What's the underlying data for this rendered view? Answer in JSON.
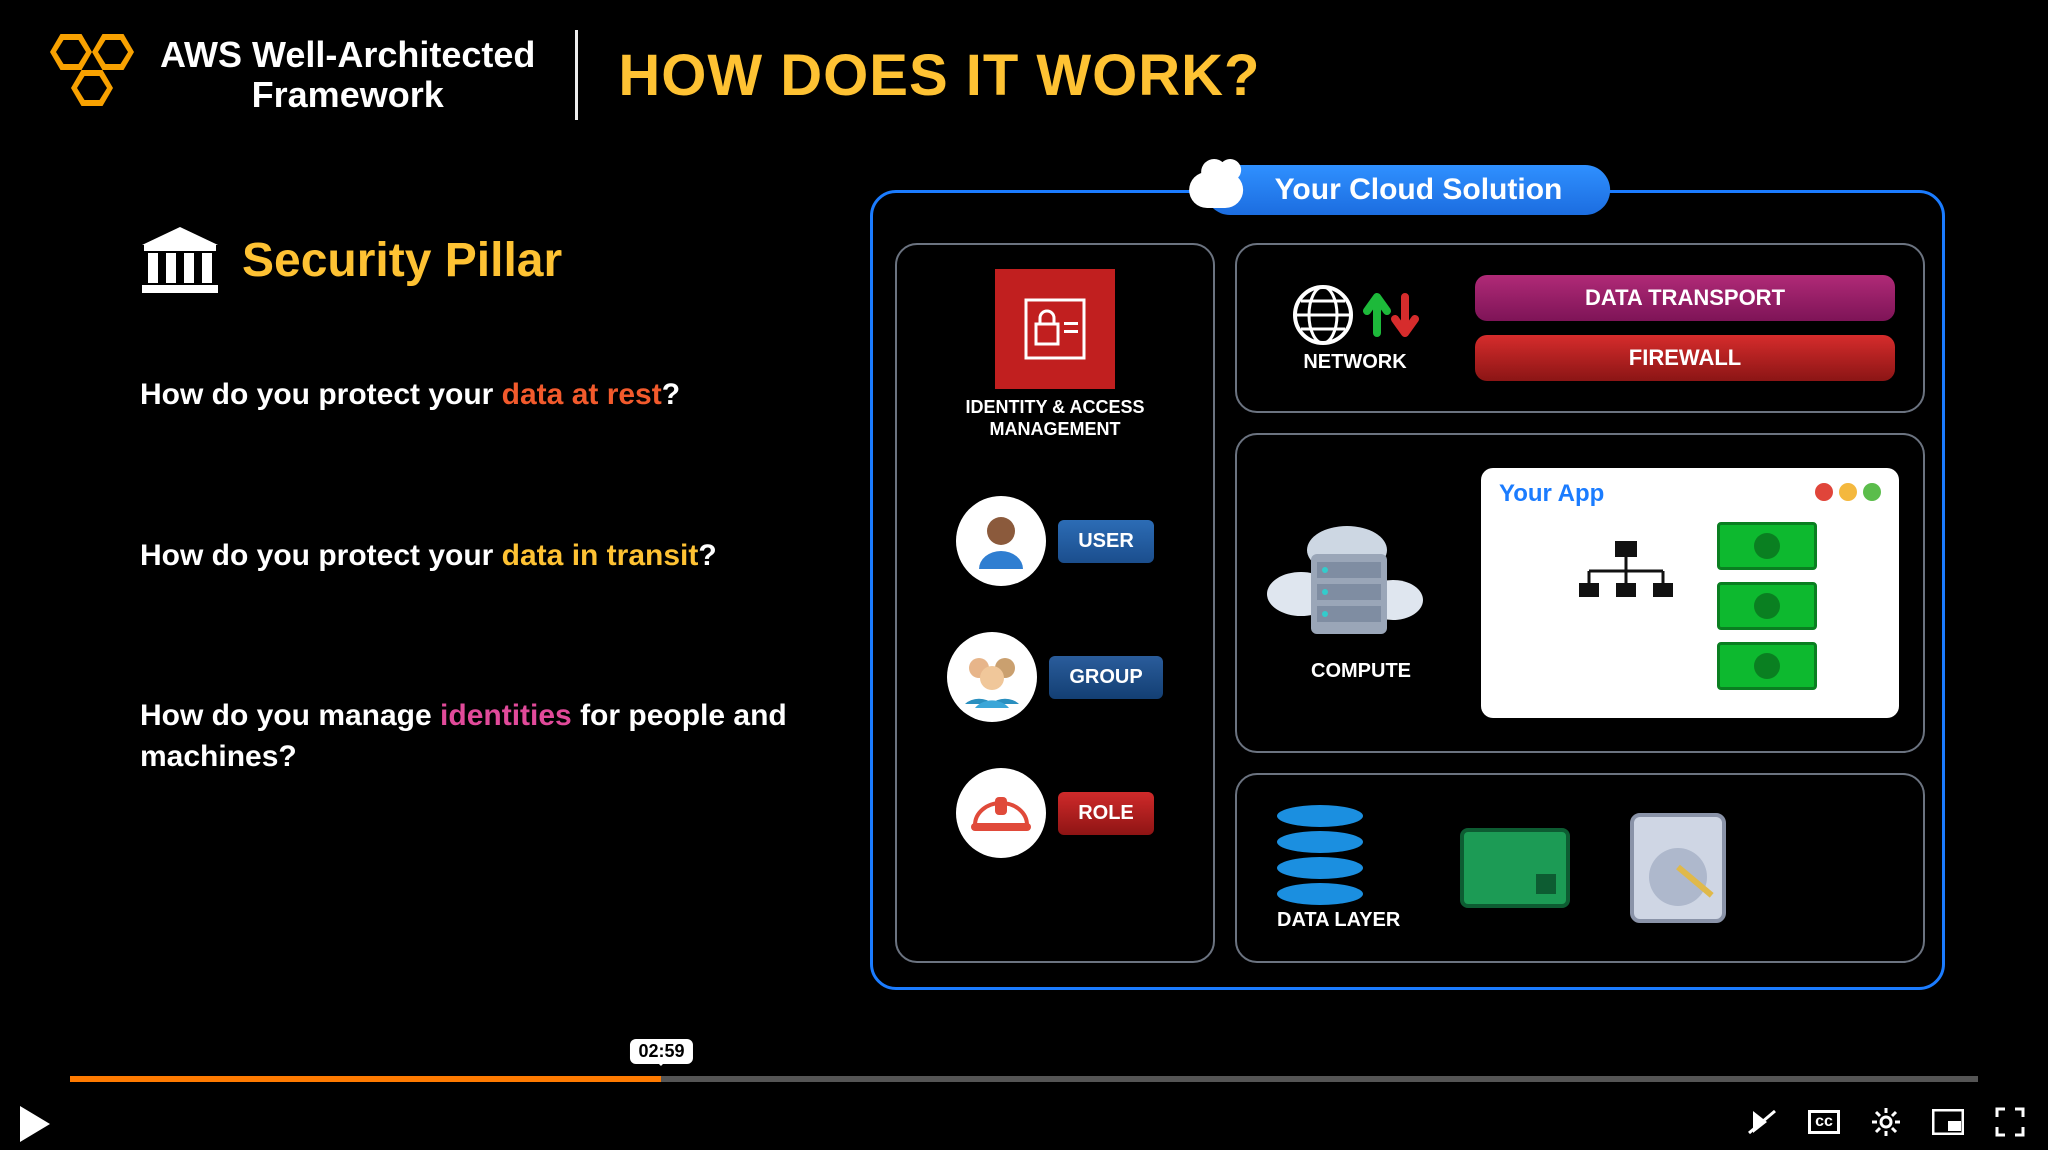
{
  "header": {
    "logo_line1": "AWS Well-Architected",
    "logo_line2": "Framework",
    "title": "HOW DOES IT WORK?"
  },
  "pillar": {
    "title": "Security Pillar"
  },
  "questions": {
    "q1_pre": "How do you protect your ",
    "q1_hl": "data at rest",
    "q1_post": "?",
    "q2_pre": "How do you protect your ",
    "q2_hl": "data in transit",
    "q2_post": "?",
    "q3_pre": "How do you manage ",
    "q3_hl": "identities",
    "q3_post": " for people and machines?"
  },
  "diagram": {
    "cloud_title": "Your Cloud Solution",
    "iam_label": "IDENTITY & ACCESS\nMANAGEMENT",
    "iam_label_l1": "IDENTITY & ACCESS",
    "iam_label_l2": "MANAGEMENT",
    "user": "USER",
    "group": "GROUP",
    "role": "ROLE",
    "network": "NETWORK",
    "data_transport": "DATA TRANSPORT",
    "firewall": "FIREWALL",
    "compute": "COMPUTE",
    "your_app": "Your App",
    "data_layer": "DATA LAYER"
  },
  "video": {
    "hover_time": "02:59",
    "progress_percent": 31
  }
}
